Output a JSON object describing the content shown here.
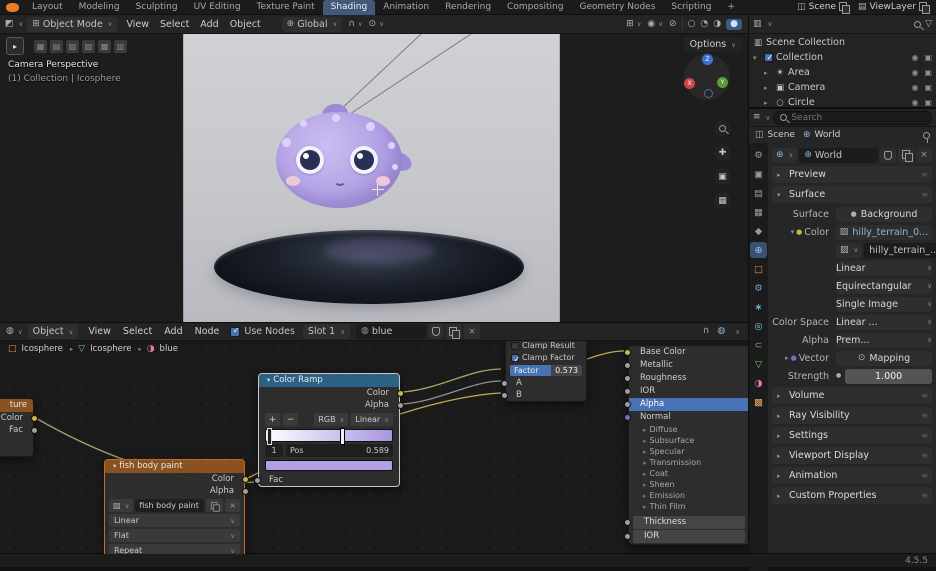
{
  "topbar": {
    "tabs": [
      {
        "label": "Layout"
      },
      {
        "label": "Modeling"
      },
      {
        "label": "Sculpting"
      },
      {
        "label": "UV Editing"
      },
      {
        "label": "Texture Paint"
      },
      {
        "label": "Shading"
      },
      {
        "label": "Animation"
      },
      {
        "label": "Rendering"
      },
      {
        "label": "Compositing"
      },
      {
        "label": "Geometry Nodes"
      },
      {
        "label": "Scripting"
      },
      {
        "label": "+"
      }
    ],
    "scene_label": "Scene",
    "viewlayer_label": "ViewLayer"
  },
  "viewport": {
    "mode": "Object Mode",
    "menus": {
      "view": "View",
      "select": "Select",
      "add": "Add",
      "object": "Object"
    },
    "orientation": "Global",
    "overlay_line1": "Camera Perspective",
    "overlay_line2": "(1) Collection | Icosphere",
    "options_label": "Options",
    "axes": {
      "x": "X",
      "y": "Y",
      "z": "Z"
    }
  },
  "outliner": {
    "rows": [
      {
        "label": "Scene Collection"
      },
      {
        "label": "Collection"
      },
      {
        "label": "Area"
      },
      {
        "label": "Camera"
      },
      {
        "label": "Circle"
      }
    ]
  },
  "properties": {
    "search_placeholder": "Search",
    "path_scene": "Scene",
    "path_world": "World",
    "world_name": "World",
    "panels": {
      "preview": "Preview",
      "surface": "Surface",
      "volume": "Volume",
      "ray": "Ray Visibility",
      "settings": "Settings",
      "viewport": "Viewport Display",
      "animation": "Animation",
      "custom": "Custom Properties"
    },
    "surface": {
      "surface_label": "Surface",
      "surface_value": "Background",
      "color_label": "Color",
      "color_value": "hilly_terrain_0...",
      "image_name": "hilly_terrain_...",
      "interpolation": "Linear",
      "projection": "Equirectangular",
      "source": "Single Image",
      "colorspace_label": "Color Space",
      "colorspace_value": "Linear ...",
      "alpha_label": "Alpha",
      "alpha_value": "Prem...",
      "vector_label": "Vector",
      "vector_value": "Mapping",
      "strength_label": "Strength",
      "strength_value": "1.000"
    }
  },
  "shader": {
    "editor_type": "Object",
    "menus": {
      "view": "View",
      "select": "Select",
      "add": "Add",
      "node": "Node"
    },
    "use_nodes": "Use Nodes",
    "slot": "Slot 1",
    "material": "blue",
    "breadcrumb": {
      "object": "Icosphere",
      "mesh": "Icosphere",
      "material": "blue"
    },
    "nodes": {
      "cut": {
        "title": "ture",
        "out_color": "Color",
        "out_fac": "Fac"
      },
      "img": {
        "title": "fish body paint",
        "out_color": "Color",
        "out_alpha": "Alpha",
        "name": "fish body paint",
        "interpolation": "Linear",
        "projection": "Flat",
        "extension": "Repeat"
      },
      "ramp": {
        "title": "Color Ramp",
        "out_color": "Color",
        "out_alpha": "Alpha",
        "add": "+",
        "remove": "−",
        "mode": "RGB",
        "interpolation": "Linear",
        "index": "1",
        "pos_label": "Pos",
        "pos_value": "0.589",
        "in_fac": "Fac"
      },
      "mix": {
        "clamp_result": "Clamp Result",
        "clamp_factor": "Clamp Factor",
        "factor_label": "Factor",
        "factor_value": "0.573",
        "a_label": "A",
        "b_label": "B"
      },
      "bsdf": {
        "inputs": [
          {
            "label": "Base Color"
          },
          {
            "label": "Metallic"
          },
          {
            "label": "Roughness"
          },
          {
            "label": "IOR"
          },
          {
            "label": "Alpha"
          },
          {
            "label": "Normal"
          }
        ],
        "sub": [
          {
            "label": "Diffuse"
          },
          {
            "label": "Subsurface"
          },
          {
            "label": "Specular"
          },
          {
            "label": "Transmission"
          },
          {
            "label": "Coat"
          },
          {
            "label": "Sheen"
          },
          {
            "label": "Emission"
          },
          {
            "label": "Thin Film"
          }
        ],
        "extra": [
          {
            "label": "Thickness"
          },
          {
            "label": "IOR"
          }
        ]
      }
    }
  },
  "statusbar": {
    "version": "4.5.5"
  },
  "colors": {
    "accent_blue": "#4772b3",
    "selection_orange": "#e8803c",
    "node_texture_header": "#8a5220",
    "node_converter_header": "#2e6284",
    "socket_color": "#c8b849",
    "socket_float": "#9e9e9e",
    "socket_vector": "#7070c8",
    "ramp_swatch": "#b2a0e2"
  }
}
